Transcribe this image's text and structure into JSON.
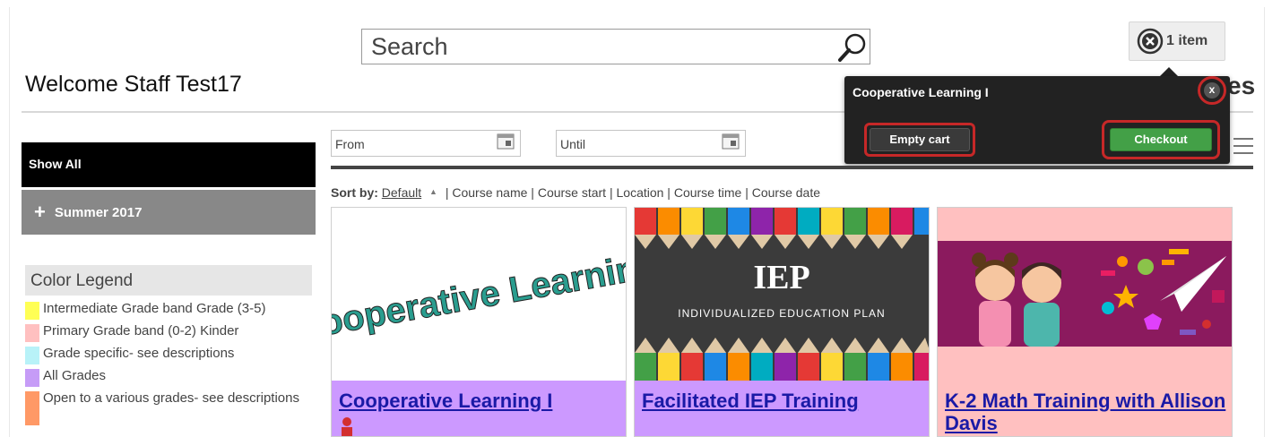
{
  "header": {
    "search_placeholder": "Search",
    "welcome": "Welcome Staff Test17",
    "truncated_heading": "es"
  },
  "cart": {
    "count_label": "1 item",
    "popup": {
      "title": "Cooperative Learning I",
      "close_label": "x",
      "empty_label": "Empty cart",
      "checkout_label": "Checkout"
    }
  },
  "sidebar": {
    "show_all": "Show All",
    "summer_plus": "+",
    "summer": "Summer 2017",
    "legend_title": "Color Legend",
    "legend": [
      {
        "label": "Intermediate Grade band Grade (3-5)",
        "color": "#ffff55"
      },
      {
        "label": "Primary Grade band (0-2) Kinder",
        "color": "#ffc0c0"
      },
      {
        "label": "Grade specific- see descriptions",
        "color": "#b8f2f8"
      },
      {
        "label": "All Grades",
        "color": "#c69cf7"
      },
      {
        "label": "Open to a various grades- see descriptions",
        "color": "#ff9966"
      }
    ]
  },
  "filters": {
    "from_placeholder": "From",
    "until_placeholder": "Until"
  },
  "sort": {
    "label": "Sort by:",
    "default": "Default",
    "arrow": "▲",
    "options": "| Course name | Course start | Location | Course time | Course date"
  },
  "courses": [
    {
      "title": "Cooperative Learning I",
      "color": "#cc99ff",
      "image_word": "Cooperative Learning"
    },
    {
      "title": "Facilitated IEP Training",
      "color": "#cc99ff",
      "image_word": "IEP",
      "image_subtitle": "INDIVIDUALIZED EDUCATION PLAN"
    },
    {
      "title": "K-2 Math Training with Allison Davis",
      "color": "#ffc0c0"
    }
  ],
  "colors": {
    "checkout": "#43a047",
    "highlight": "#c62828",
    "link": "#1a1aa6"
  }
}
